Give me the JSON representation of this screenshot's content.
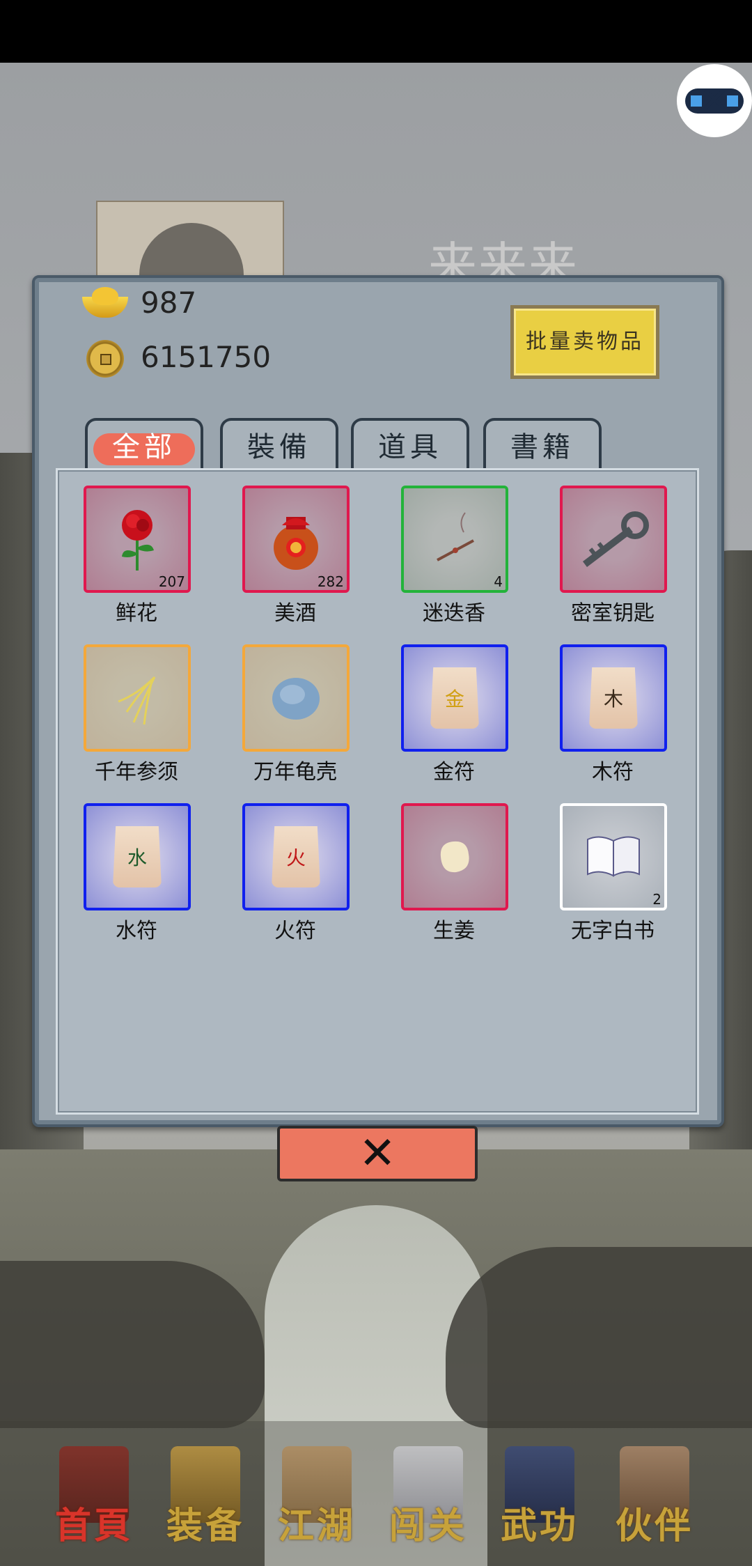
{
  "background": {
    "title": "来来来"
  },
  "currency": {
    "gold": "987",
    "coins": "6151750"
  },
  "sell_button": "批量卖物品",
  "tabs": [
    {
      "label": "全部",
      "active": true
    },
    {
      "label": "裝備",
      "active": false
    },
    {
      "label": "道具",
      "active": false
    },
    {
      "label": "書籍",
      "active": false
    }
  ],
  "items": [
    {
      "name": "鲜花",
      "count": "207",
      "frame": "red",
      "icon": "rose-icon"
    },
    {
      "name": "美酒",
      "count": "282",
      "frame": "red",
      "icon": "wine-jar-icon"
    },
    {
      "name": "迷迭香",
      "count": "4",
      "frame": "green",
      "icon": "incense-icon"
    },
    {
      "name": "密室钥匙",
      "count": "",
      "frame": "red",
      "icon": "key-icon"
    },
    {
      "name": "千年参须",
      "count": "",
      "frame": "orange",
      "icon": "ginseng-icon"
    },
    {
      "name": "万年龟壳",
      "count": "",
      "frame": "orange",
      "icon": "turtle-shell-icon"
    },
    {
      "name": "金符",
      "count": "",
      "frame": "blue",
      "icon": "charm-icon",
      "glyph": "金"
    },
    {
      "name": "木符",
      "count": "",
      "frame": "blue",
      "icon": "charm-icon",
      "glyph": "木"
    },
    {
      "name": "水符",
      "count": "",
      "frame": "blue",
      "icon": "charm-icon",
      "glyph": "水"
    },
    {
      "name": "火符",
      "count": "",
      "frame": "blue",
      "icon": "charm-icon",
      "glyph": "火"
    },
    {
      "name": "生姜",
      "count": "",
      "frame": "red",
      "icon": "ginger-icon"
    },
    {
      "name": "无字白书",
      "count": "2",
      "frame": "white",
      "icon": "book-icon"
    }
  ],
  "close_button": "✕",
  "nav": [
    {
      "label": "首頁",
      "active": true
    },
    {
      "label": "装备",
      "active": false
    },
    {
      "label": "江湖",
      "active": false
    },
    {
      "label": "闯关",
      "active": false
    },
    {
      "label": "武功",
      "active": false
    },
    {
      "label": "伙伴",
      "active": false
    }
  ]
}
